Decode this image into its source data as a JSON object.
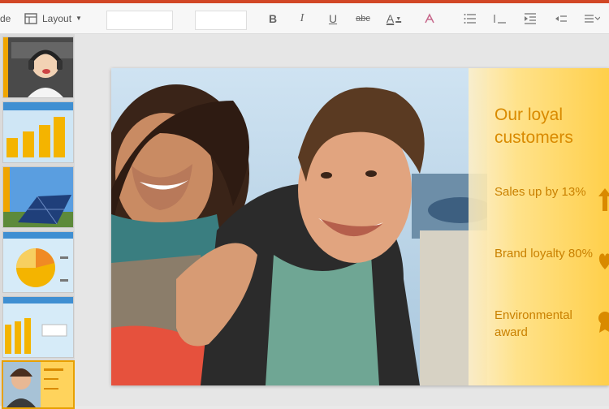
{
  "toolbar": {
    "partial_label": "de",
    "layout_label": "Layout",
    "icons": [
      "layout-icon",
      "chevron-down-icon",
      "bold-icon",
      "italic-icon",
      "underline-icon",
      "strikethrough-icon",
      "font-color-icon",
      "clear-format-icon",
      "bullets-icon",
      "numbering-icon",
      "decrease-indent-icon",
      "increase-indent-icon",
      "align-icon"
    ],
    "bold": "B",
    "italic": "I",
    "underline": "U",
    "strike": "abc",
    "font_color": "A"
  },
  "sidebar": {
    "thumbnails": [
      {
        "name": "slide-thumb-1",
        "desc": "photo-boy-headphones"
      },
      {
        "name": "slide-thumb-2",
        "desc": "bar-chart"
      },
      {
        "name": "slide-thumb-3",
        "desc": "solar-panel"
      },
      {
        "name": "slide-thumb-4",
        "desc": "pie-chart"
      },
      {
        "name": "slide-thumb-5",
        "desc": "bar-chart-2"
      },
      {
        "name": "slide-thumb-6",
        "desc": "our-loyal-customers",
        "selected": true
      }
    ]
  },
  "slide": {
    "title": "Our loyal customers",
    "stats": [
      {
        "text": "Sales up by 13%",
        "icon": "up-arrow-icon"
      },
      {
        "text": "Brand loyalty 80%",
        "icon": "heart-icon"
      },
      {
        "text": "Environmental award",
        "icon": "award-icon"
      }
    ]
  },
  "colors": {
    "accent": "#d24726",
    "panel": "#ffd35c",
    "panel_text": "#d98a00",
    "selection": "#e8a000"
  }
}
